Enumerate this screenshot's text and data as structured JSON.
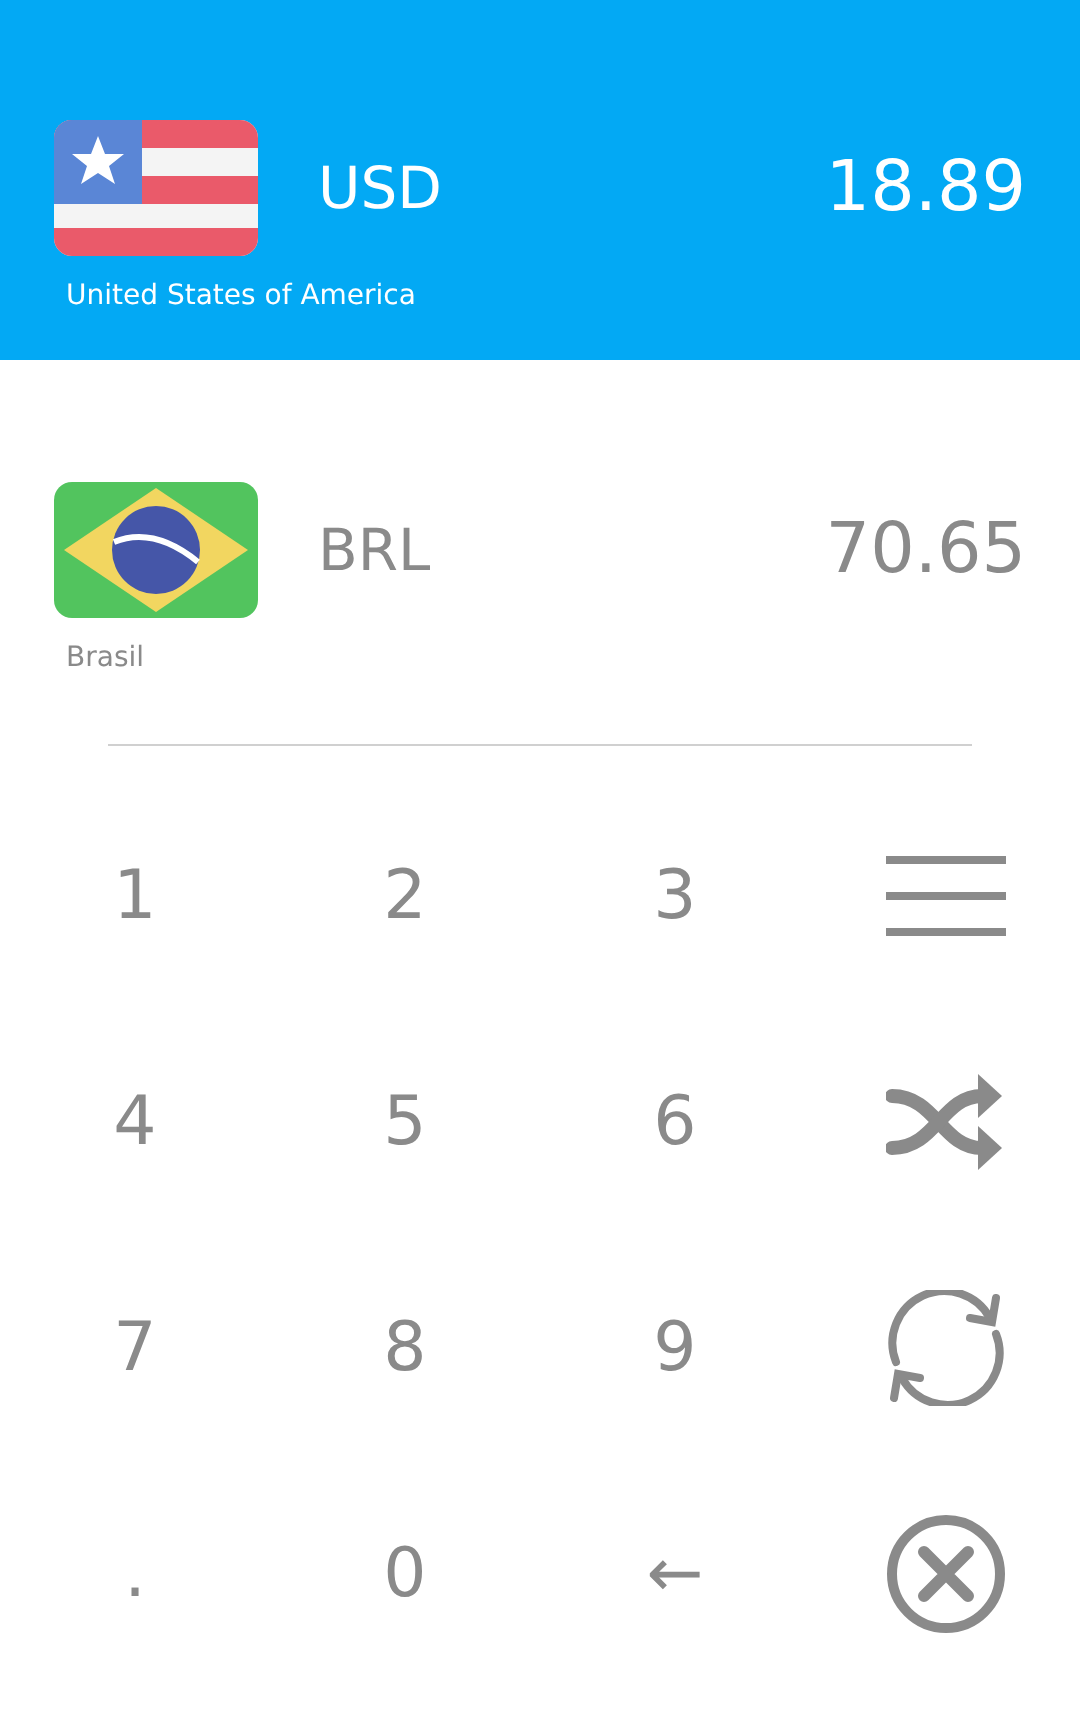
{
  "currencies": [
    {
      "code": "USD",
      "country": "United States of America",
      "amount": "18.89",
      "kind": "us",
      "selected": true
    },
    {
      "code": "BRL",
      "country": "Brasil",
      "amount": "70.65",
      "kind": "br",
      "selected": false
    }
  ],
  "keypad": [
    {
      "kind": "text",
      "label": "1"
    },
    {
      "kind": "text",
      "label": "2"
    },
    {
      "kind": "text",
      "label": "3"
    },
    {
      "kind": "menu"
    },
    {
      "kind": "text",
      "label": "4"
    },
    {
      "kind": "text",
      "label": "5"
    },
    {
      "kind": "text",
      "label": "6"
    },
    {
      "kind": "shuffle"
    },
    {
      "kind": "text",
      "label": "7"
    },
    {
      "kind": "text",
      "label": "8"
    },
    {
      "kind": "text",
      "label": "9"
    },
    {
      "kind": "refresh"
    },
    {
      "kind": "text",
      "label": "."
    },
    {
      "kind": "text",
      "label": "0"
    },
    {
      "kind": "text",
      "label": "←"
    },
    {
      "kind": "clear"
    }
  ]
}
